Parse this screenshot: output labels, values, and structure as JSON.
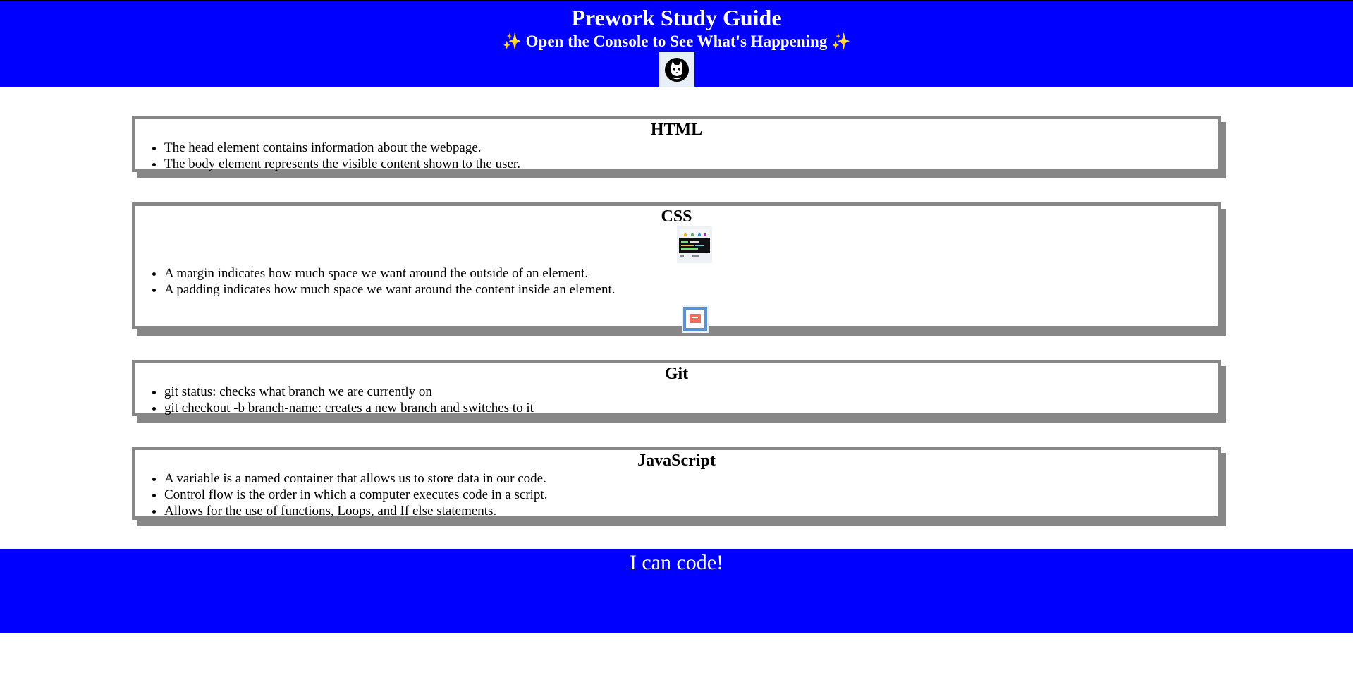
{
  "header": {
    "title": "Prework Study Guide",
    "subtitle": "Open the Console to See What's Happening",
    "sparkle": "✨",
    "logo_icon": "cat-face-icon"
  },
  "sections": {
    "html": {
      "title": "HTML",
      "items": [
        "The head element contains information about the webpage.",
        "The body element represents the visible content shown to the user."
      ]
    },
    "css": {
      "title": "CSS",
      "items": [
        "A margin indicates how much space we want around the outside of an element.",
        "A padding indicates how much space we want around the content inside an element."
      ],
      "images": [
        "css-editor-thumbnail",
        "box-model-thumbnail"
      ]
    },
    "git": {
      "title": "Git",
      "items": [
        "git status: checks what branch we are currently on",
        "git checkout -b branch-name: creates a new branch and switches to it"
      ]
    },
    "javascript": {
      "title": "JavaScript",
      "items": [
        "A variable is a named container that allows us to store data in our code.",
        "Control flow is the order in which a computer executes code in a script.",
        "Allows for the use of functions, Loops, and If else statements."
      ]
    }
  },
  "footer": {
    "text": "I can code!"
  },
  "colors": {
    "header_bg": "#0000ff",
    "footer_bg": "#0000ff",
    "card_border": "#878787",
    "sparkle": "#f6c14b"
  }
}
